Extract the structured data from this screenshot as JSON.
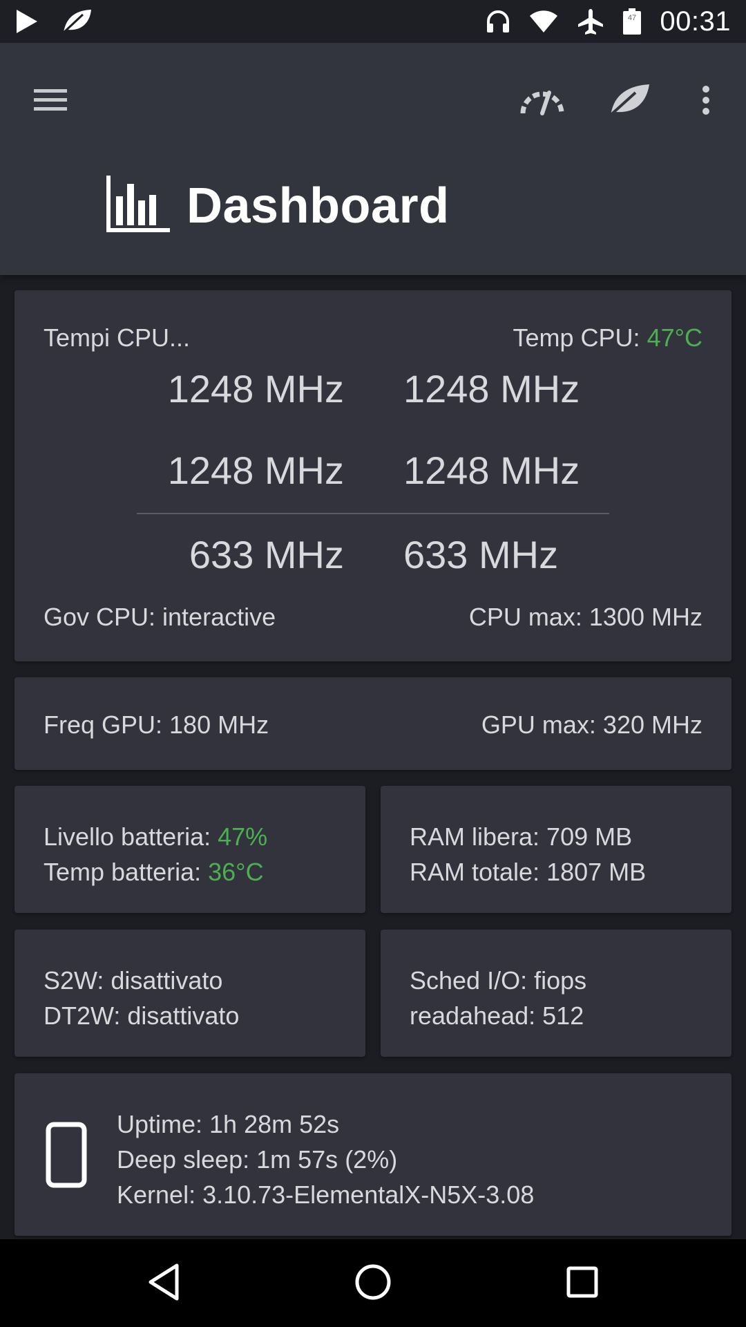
{
  "status_bar": {
    "time": "00:31",
    "battery_level": "47",
    "icons": [
      "play-icon",
      "leaf-icon",
      "headphones-icon",
      "wifi-icon",
      "airplane-icon",
      "battery-icon"
    ]
  },
  "toolbar": {
    "title": "Dashboard",
    "icons": [
      "menu-icon",
      "speedometer-icon",
      "leaf-icon",
      "more-vert-icon",
      "bar-chart-icon"
    ]
  },
  "cpu": {
    "times_label": "Tempi CPU...",
    "temp_label": "Temp CPU: ",
    "temp_value": "47°C",
    "freqs": [
      "1248 MHz",
      "1248 MHz",
      "1248 MHz",
      "1248 MHz",
      "633 MHz",
      "633 MHz"
    ],
    "governor": "Gov CPU: interactive",
    "max": "CPU max: 1300 MHz"
  },
  "gpu": {
    "freq": "Freq GPU: 180 MHz",
    "max": "GPU max: 320 MHz"
  },
  "battery": {
    "level_label": "Livello batteria: ",
    "level_value": "47%",
    "temp_label": "Temp batteria: ",
    "temp_value": "36°C"
  },
  "ram": {
    "free": "RAM libera: 709 MB",
    "total": "RAM totale: 1807 MB"
  },
  "gestures": {
    "s2w": "S2W: disattivato",
    "dt2w": "DT2W: disattivato"
  },
  "io": {
    "scheduler": "Sched I/O: fiops",
    "readahead": "readahead: 512"
  },
  "system": {
    "uptime": "Uptime: 1h 28m 52s",
    "deep_sleep": "Deep sleep: 1m 57s (2%)",
    "kernel": "Kernel: 3.10.73-ElementalX-N5X-3.08"
  },
  "nav_bar": {
    "icons": [
      "back-icon",
      "home-icon",
      "recents-icon"
    ]
  },
  "colors": {
    "accent_green": "#4caf50",
    "toolbar_bg": "#32343e",
    "card_bg": "#32333d",
    "page_bg": "#1c1d22"
  }
}
